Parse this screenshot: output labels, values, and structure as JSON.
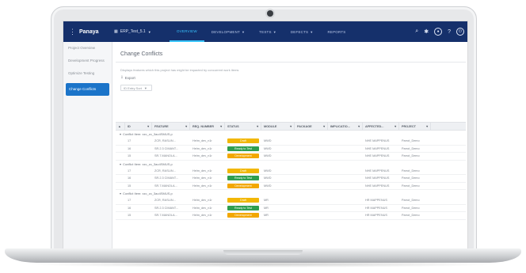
{
  "brand": "Panaya",
  "project": "ERP_Test_5.1",
  "nav": [
    {
      "label": "OVERVIEW",
      "active": true,
      "caret": false
    },
    {
      "label": "DEVELOPMENT",
      "active": false,
      "caret": true
    },
    {
      "label": "TESTS",
      "active": false,
      "caret": true
    },
    {
      "label": "DEFECTS",
      "active": false,
      "caret": true
    },
    {
      "label": "REPORTS",
      "active": false,
      "caret": false
    }
  ],
  "sidebar": [
    {
      "label": "Project Overview",
      "active": false
    },
    {
      "label": "Development Progress",
      "active": false
    },
    {
      "label": "Optimize Testing",
      "active": false
    },
    {
      "label": "Change Conflicts",
      "active": true
    }
  ],
  "page": {
    "title": "Change Conflicts",
    "description": "Displays features which this project has might be impacted by concurrent work items",
    "export_label": "Export",
    "group_label": "ID Entry Sort"
  },
  "columns": [
    "ID",
    "FEATURE",
    "REQ. NUMBER",
    "STATUS",
    "MODULE",
    "PACKAGE",
    "IMPLICATIO...",
    "AFFECTED...",
    "PROJECT"
  ],
  "groups": [
    {
      "label": "Conflict Item: xzc_zc_3ao4SMUS.p",
      "rows": [
        {
          "id": "17",
          "feature": "ZCR, RASLIN...",
          "req": "Helm_dev_n1r",
          "status": "Draft",
          "color": "#f2b705",
          "module": "MWD",
          "affected": "NHE MAPPENUS",
          "project": "Parrot_Demo"
        },
        {
          "id": "16",
          "feature": "SR.2.3 CIMANT...",
          "req": "Helm_dev_n1r",
          "status": "Ready to Test",
          "color": "#2e9e4f",
          "module": "MWD",
          "affected": "NHE MAPPENUS",
          "project": "Parrot_Demo"
        },
        {
          "id": "15",
          "feature": "SR.7.MANOLA...",
          "req": "Helm_dev_n1r",
          "status": "Development",
          "color": "#f2a700",
          "module": "MWD",
          "affected": "NHE MAPPENUS",
          "project": "Parrot_Demo"
        }
      ]
    },
    {
      "label": "Conflict Item: xzc_zc_3ao4SMUS.p",
      "rows": [
        {
          "id": "17",
          "feature": "ZCR, RASLIN...",
          "req": "Helm_dev_n1r",
          "status": "Draft",
          "color": "#f2b705",
          "module": "MWD",
          "affected": "NHE MAPPENUS",
          "project": "Parrot_Demo"
        },
        {
          "id": "16",
          "feature": "SR.2.3 CIMANT...",
          "req": "Helm_dev_n1r",
          "status": "Ready to Test",
          "color": "#2e9e4f",
          "module": "MWD",
          "affected": "NHE MAPPENUS",
          "project": "Parrot_Demo"
        },
        {
          "id": "15",
          "feature": "SR.7.MANOLA...",
          "req": "Helm_dev_n1r",
          "status": "Development",
          "color": "#f2a700",
          "module": "MWD",
          "affected": "NHE MAPPENUS",
          "project": "Parrot_Demo"
        }
      ]
    },
    {
      "label": "Conflict Item: xzc_zc_3ao4SMUS.p",
      "rows": [
        {
          "id": "17",
          "feature": "ZCR, RASLIN...",
          "req": "Helm_dev_n1r",
          "status": "Draft",
          "color": "#f2b705",
          "module": "MR",
          "affected": "HR MAPPENUS",
          "project": "Parrot_Demo"
        },
        {
          "id": "16",
          "feature": "SR.2.3 CIMANT...",
          "req": "Helm_dev_n1r",
          "status": "Ready to Test",
          "color": "#2e9e4f",
          "module": "MR",
          "affected": "HR MAPPENUS",
          "project": "Parrot_Demo"
        },
        {
          "id": "15",
          "feature": "SR.7.MANOLA...",
          "req": "Helm_dev_n1r",
          "status": "Development",
          "color": "#f2a700",
          "module": "MR",
          "affected": "HR MAPPENUS",
          "project": "Parrot_Demo"
        }
      ]
    }
  ]
}
